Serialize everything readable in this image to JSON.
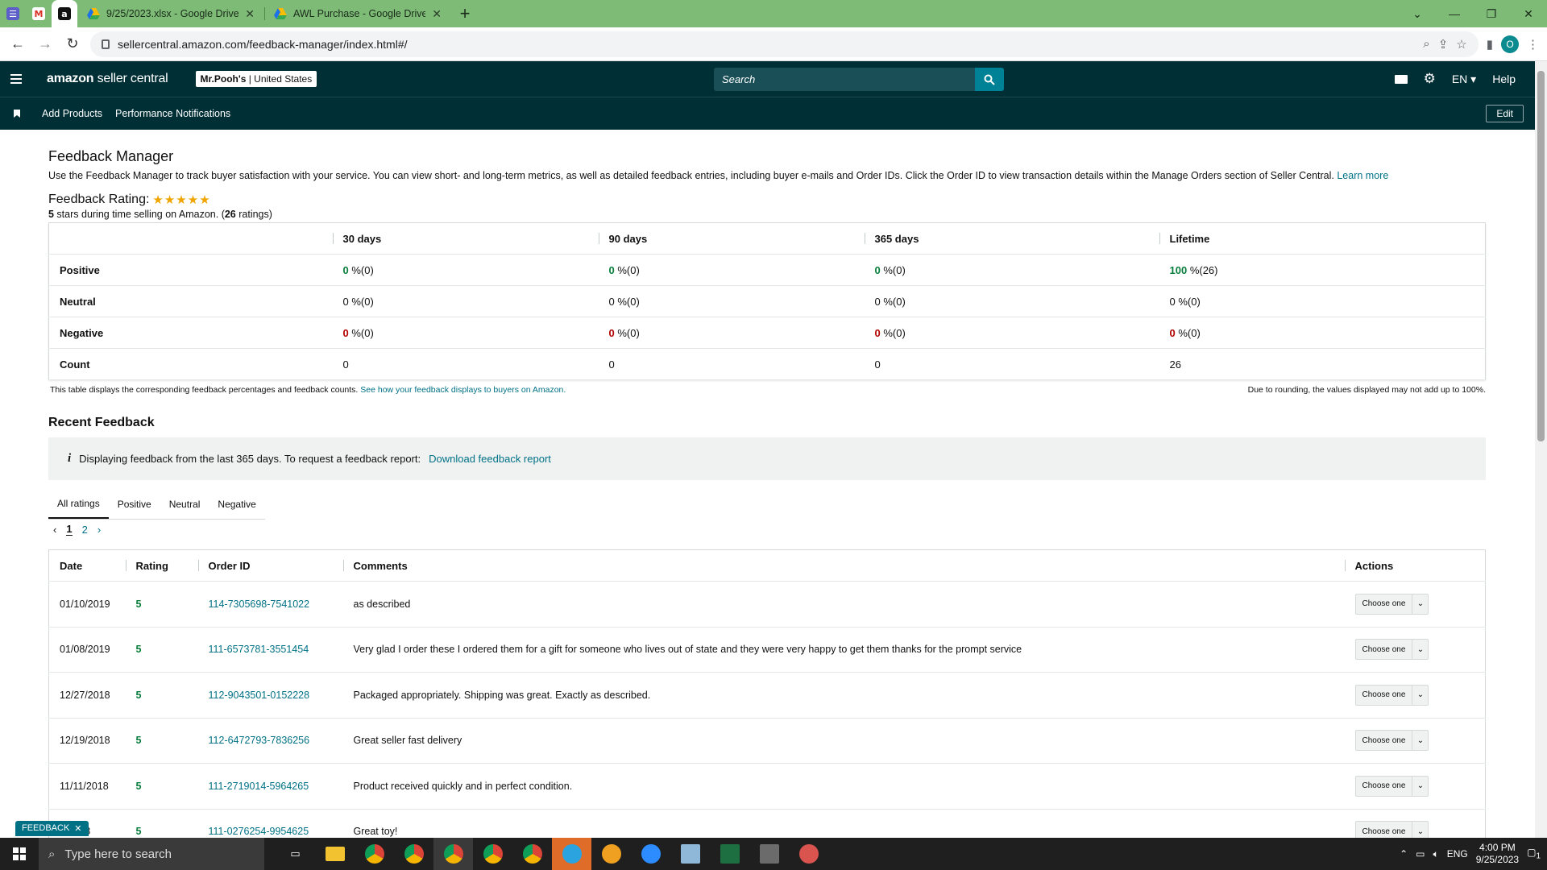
{
  "browser": {
    "tabs": [
      {
        "title": "9/25/2023.xlsx - Google Drive"
      },
      {
        "title": "AWL Purchase - Google Drive"
      }
    ],
    "url": "sellercentral.amazon.com/feedback-manager/index.html#/",
    "profile_initial": "O"
  },
  "header": {
    "logo_bold": "amazon",
    "logo_rest": " seller central",
    "store_name": "Mr.Pooh's",
    "store_region": " | United States",
    "search_placeholder": "Search",
    "language": "EN",
    "help": "Help"
  },
  "navbar": {
    "links": [
      "Add Products",
      "Performance Notifications"
    ],
    "edit": "Edit"
  },
  "page": {
    "title": "Feedback Manager",
    "intro": "Use the Feedback Manager to track buyer satisfaction with your service. You can view short- and long-term metrics, as well as detailed feedback entries, including buyer e-mails and Order IDs. Click the Order ID to view transaction details within the Manage Orders section of Seller Central.",
    "learn_more": "Learn more",
    "rating_label": "Feedback Rating:",
    "rating_stars": 5,
    "rating_sub_bold": "5",
    "rating_sub_text": " stars during time selling on Amazon. (",
    "rating_count": "26",
    "rating_sub_end": " ratings)"
  },
  "metrics": {
    "periods": [
      "30 days",
      "90 days",
      "365 days",
      "Lifetime"
    ],
    "rows": [
      {
        "label": "Positive",
        "class": "g",
        "cells": [
          [
            "0",
            " %(0)"
          ],
          [
            "0",
            " %(0)"
          ],
          [
            "0",
            " %(0)"
          ],
          [
            "100",
            " %(26)"
          ]
        ]
      },
      {
        "label": "Neutral",
        "class": "",
        "cells": [
          [
            "0",
            " %(0)"
          ],
          [
            "0",
            " %(0)"
          ],
          [
            "0",
            " %(0)"
          ],
          [
            "0",
            " %(0)"
          ]
        ]
      },
      {
        "label": "Negative",
        "class": "r",
        "cells": [
          [
            "0",
            " %(0)"
          ],
          [
            "0",
            " %(0)"
          ],
          [
            "0",
            " %(0)"
          ],
          [
            "0",
            " %(0)"
          ]
        ]
      },
      {
        "label": "Count",
        "class": "plain",
        "cells": [
          [
            "0",
            ""
          ],
          [
            "0",
            ""
          ],
          [
            "0",
            ""
          ],
          [
            "26",
            ""
          ]
        ]
      }
    ],
    "note_left": "This table displays the corresponding feedback percentages and feedback counts.",
    "note_left_link": "See how your feedback displays to buyers on Amazon.",
    "note_right": "Due to rounding, the values displayed may not add up to 100%."
  },
  "recent": {
    "title": "Recent Feedback",
    "info_text": "Displaying feedback from the last 365 days. To request a feedback report:",
    "info_link": "Download feedback report",
    "filters": [
      "All ratings",
      "Positive",
      "Neutral",
      "Negative"
    ],
    "pages": [
      "1",
      "2"
    ],
    "columns": [
      "Date",
      "Rating",
      "Order ID",
      "Comments",
      "Actions"
    ],
    "action_label": "Choose one",
    "rows": [
      {
        "date": "01/10/2019",
        "rating": "5",
        "order": "114-7305698-7541022",
        "comment": "as described"
      },
      {
        "date": "01/08/2019",
        "rating": "5",
        "order": "111-6573781-3551454",
        "comment": "Very glad I order these I ordered them for a gift for someone who lives out of state and they were very happy to get them thanks for the prompt service"
      },
      {
        "date": "12/27/2018",
        "rating": "5",
        "order": "112-9043501-0152228",
        "comment": "Packaged appropriately. Shipping was great. Exactly as described."
      },
      {
        "date": "12/19/2018",
        "rating": "5",
        "order": "112-6472793-7836256",
        "comment": "Great seller fast delivery"
      },
      {
        "date": "11/11/2018",
        "rating": "5",
        "order": "111-2719014-5964265",
        "comment": "Product received quickly and in perfect condition."
      },
      {
        "date": "1/2018",
        "rating": "5",
        "order": "111-0276254-9954625",
        "comment": "Great toy!"
      }
    ]
  },
  "feedback_pill": "FEEDBACK",
  "taskbar": {
    "search_placeholder": "Type here to search",
    "lang": "ENG",
    "time": "4:00 PM",
    "date": "9/25/2023",
    "notif_count": "1"
  },
  "colors": {
    "header_bg": "#002f36",
    "tabbar_bg": "#7dbb76",
    "link": "#007185",
    "positive": "#067d3a",
    "negative": "#b30000",
    "star": "#f0a400"
  }
}
